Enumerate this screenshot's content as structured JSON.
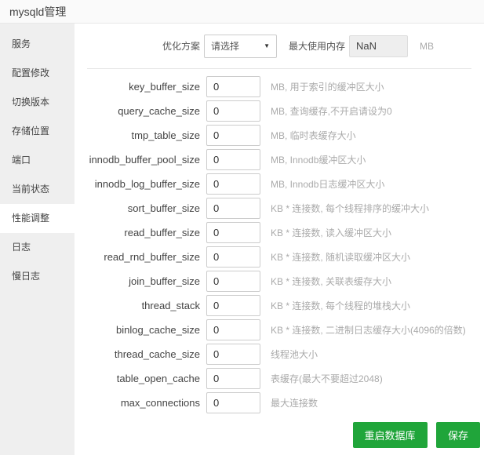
{
  "window": {
    "title": "mysqld管理"
  },
  "sidebar": {
    "items": [
      {
        "label": "服务",
        "active": false
      },
      {
        "label": "配置修改",
        "active": false
      },
      {
        "label": "切换版本",
        "active": false
      },
      {
        "label": "存储位置",
        "active": false
      },
      {
        "label": "端口",
        "active": false
      },
      {
        "label": "当前状态",
        "active": false
      },
      {
        "label": "性能调整",
        "active": true
      },
      {
        "label": "日志",
        "active": false
      },
      {
        "label": "慢日志",
        "active": false
      }
    ]
  },
  "optimization": {
    "label": "优化方案",
    "select_value": "请选择",
    "caret_icon": "▼",
    "memory_label": "最大使用内存",
    "memory_value": "NaN",
    "memory_unit": "MB"
  },
  "form": {
    "rows": [
      {
        "name": "key_buffer_size",
        "value": "0",
        "hint": "MB, 用于索引的缓冲区大小"
      },
      {
        "name": "query_cache_size",
        "value": "0",
        "hint": "MB, 查询缓存,不开启请设为0"
      },
      {
        "name": "tmp_table_size",
        "value": "0",
        "hint": "MB, 临时表缓存大小"
      },
      {
        "name": "innodb_buffer_pool_size",
        "value": "0",
        "hint": "MB, Innodb缓冲区大小"
      },
      {
        "name": "innodb_log_buffer_size",
        "value": "0",
        "hint": "MB, Innodb日志缓冲区大小"
      },
      {
        "name": "sort_buffer_size",
        "value": "0",
        "hint": "KB * 连接数, 每个线程排序的缓冲大小"
      },
      {
        "name": "read_buffer_size",
        "value": "0",
        "hint": "KB * 连接数, 读入缓冲区大小"
      },
      {
        "name": "read_rnd_buffer_size",
        "value": "0",
        "hint": "KB * 连接数, 随机读取缓冲区大小"
      },
      {
        "name": "join_buffer_size",
        "value": "0",
        "hint": "KB * 连接数, 关联表缓存大小"
      },
      {
        "name": "thread_stack",
        "value": "0",
        "hint": "KB * 连接数, 每个线程的堆栈大小"
      },
      {
        "name": "binlog_cache_size",
        "value": "0",
        "hint": "KB * 连接数, 二进制日志缓存大小(4096的倍数)"
      },
      {
        "name": "thread_cache_size",
        "value": "0",
        "hint": "线程池大小"
      },
      {
        "name": "table_open_cache",
        "value": "0",
        "hint": "表缓存(最大不要超过2048)"
      },
      {
        "name": "max_connections",
        "value": "0",
        "hint": "最大连接数"
      }
    ]
  },
  "buttons": {
    "restart": "重启数据库",
    "save": "保存"
  },
  "colors": {
    "accent_green": "#20a53a",
    "sidebar_bg": "#efefef",
    "hint_text": "#aaaaaa"
  }
}
